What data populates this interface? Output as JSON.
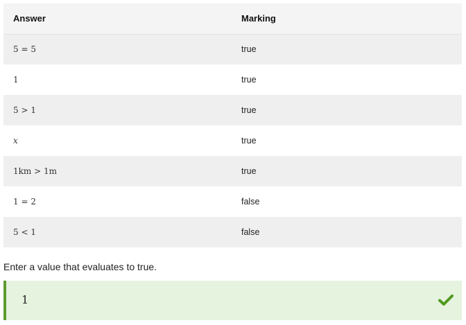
{
  "table": {
    "headers": {
      "answer": "Answer",
      "marking": "Marking"
    },
    "rows": [
      {
        "answer": "5 = 5",
        "marking": "true"
      },
      {
        "answer": "1",
        "marking": "true"
      },
      {
        "answer": "5 > 1",
        "marking": "true"
      },
      {
        "answer": "x",
        "marking": "true"
      },
      {
        "answer": "1km > 1m",
        "marking": "true"
      },
      {
        "answer": "1 = 2",
        "marking": "false"
      },
      {
        "answer": "5 < 1",
        "marking": "false"
      }
    ]
  },
  "prompt": "Enter a value that evaluates to true.",
  "answer_input": {
    "value": "1",
    "status_icon": "check-icon"
  },
  "colors": {
    "correct_background": "#e6f3df",
    "correct_border": "#5e9b2f",
    "check_mark": "#4f9a1f"
  }
}
